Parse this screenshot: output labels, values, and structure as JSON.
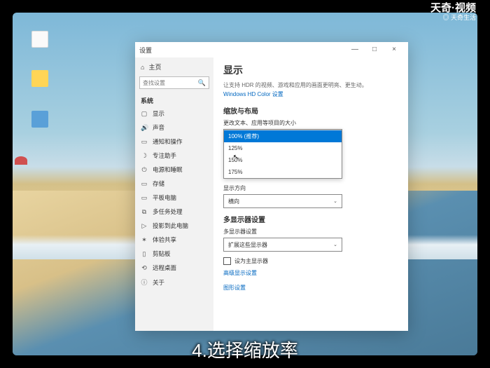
{
  "watermark": {
    "line1": "天奇·视频",
    "line2": "◎ 天奇生活"
  },
  "caption": "4.选择缩放率",
  "desktop": {
    "i1": "",
    "i2": "",
    "i3": ""
  },
  "window": {
    "title": "设置",
    "min": "—",
    "max": "□",
    "close": "×",
    "home": "主页",
    "search_placeholder": "查找设置",
    "group": "系统",
    "nav": [
      {
        "icon": "▢",
        "label": "显示"
      },
      {
        "icon": "🔊",
        "label": "声音"
      },
      {
        "icon": "▭",
        "label": "通知和操作"
      },
      {
        "icon": "☽",
        "label": "专注助手"
      },
      {
        "icon": "⏻",
        "label": "电源和睡眠"
      },
      {
        "icon": "▭",
        "label": "存储"
      },
      {
        "icon": "▭",
        "label": "平板电脑"
      },
      {
        "icon": "⧉",
        "label": "多任务处理"
      },
      {
        "icon": "▷",
        "label": "投影到此电脑"
      },
      {
        "icon": "✶",
        "label": "体验共享"
      },
      {
        "icon": "▯",
        "label": "剪贴板"
      },
      {
        "icon": "⟲",
        "label": "远程桌面"
      },
      {
        "icon": "ⓘ",
        "label": "关于"
      }
    ]
  },
  "content": {
    "h1": "显示",
    "desc": "让支持 HDR 的视频、游戏和应用的画面更明亮、更生动。",
    "hdr_link": "Windows HD Color 设置",
    "h2_scale": "缩放与布局",
    "scale_label": "更改文本、应用等项目的大小",
    "scale_options": [
      "100% (推荐)",
      "125%",
      "150%",
      "175%"
    ],
    "orient_label": "显示方向",
    "orient_value": "横向",
    "h2_multi": "多显示器设置",
    "multi_label": "多显示器设置",
    "multi_value": "扩展这些显示器",
    "checkbox": "设为主显示器",
    "adv_link": "高级显示设置",
    "gfx_link": "图形设置"
  }
}
